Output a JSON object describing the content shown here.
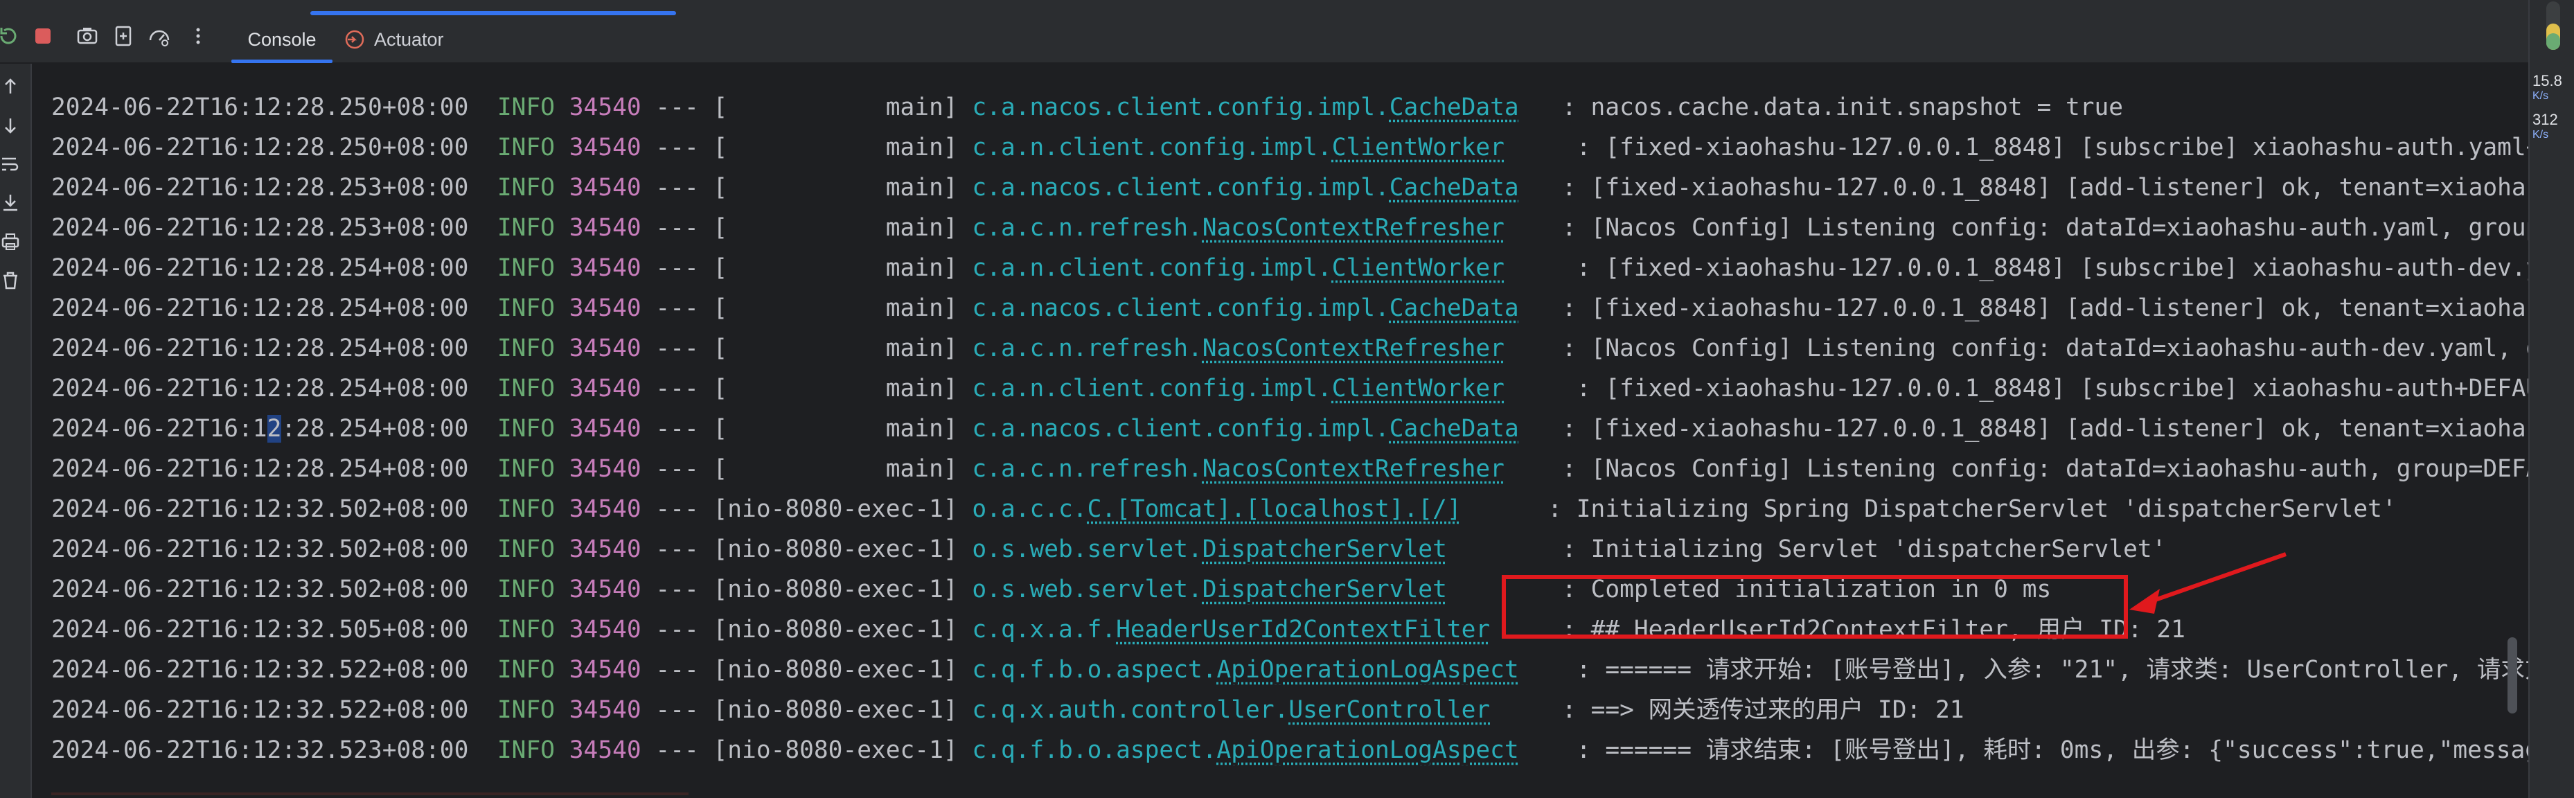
{
  "tabs": [
    {
      "label": "Console"
    },
    {
      "label": "Actuator"
    }
  ],
  "icons": {
    "toolbar": [
      "rerun-icon",
      "stop-icon",
      "camera-icon",
      "restore-icon",
      "gauge-icon",
      "more-icon"
    ],
    "gutter": [
      "scroll-up-icon",
      "scroll-down-icon",
      "soft-wrap-icon",
      "scroll-to-end-icon",
      "print-icon",
      "trash-icon"
    ],
    "actuator": "actuator-icon"
  },
  "colors": {
    "timestamp": "#bcbec4",
    "level": "#6aab73",
    "pid": "#c77dbb",
    "logger": "#2aacb8",
    "annotation": "#e0191d",
    "accent": "#3574f0"
  },
  "right_panel": {
    "value1": "15.8",
    "unit1": "K/s",
    "value2": "312",
    "unit2": "K/s"
  },
  "annotation_text_highlight": "2",
  "log_lines": [
    {
      "ts": "2024-06-22T16:12:28.250+08:00",
      "lvl": "INFO",
      "pid": "34540",
      "sep": "---",
      "thread": "[           main]",
      "lg_pre": "c.a.nacos.client.config.impl.",
      "lg_cls": "CacheData",
      "pad": "   ",
      "msg": ": nacos.cache.data.init.snapshot = true"
    },
    {
      "ts": "2024-06-22T16:12:28.250+08:00",
      "lvl": "INFO",
      "pid": "34540",
      "sep": "---",
      "thread": "[           main]",
      "lg_pre": "c.a.n.client.config.impl.",
      "lg_cls": "ClientWorker",
      "pad": "     ",
      "msg": ": [fixed-xiaohashu-127.0.0.1_8848] [subscribe] xiaohashu-auth.yaml+DEFAULT_GROUP"
    },
    {
      "ts": "2024-06-22T16:12:28.253+08:00",
      "lvl": "INFO",
      "pid": "34540",
      "sep": "---",
      "thread": "[           main]",
      "lg_pre": "c.a.nacos.client.config.impl.",
      "lg_cls": "CacheData",
      "pad": "   ",
      "msg": ": [fixed-xiaohashu-127.0.0.1_8848] [add-listener] ok, tenant=xiaohashu, dataId="
    },
    {
      "ts": "2024-06-22T16:12:28.253+08:00",
      "lvl": "INFO",
      "pid": "34540",
      "sep": "---",
      "thread": "[           main]",
      "lg_pre": "c.a.c.n.refresh.",
      "lg_cls": "NacosContextRefresher",
      "pad": "    ",
      "msg": ": [Nacos Config] Listening config: dataId=xiaohashu-auth.yaml, group=DEFAULT_GROUP"
    },
    {
      "ts": "2024-06-22T16:12:28.254+08:00",
      "lvl": "INFO",
      "pid": "34540",
      "sep": "---",
      "thread": "[           main]",
      "lg_pre": "c.a.n.client.config.impl.",
      "lg_cls": "ClientWorker",
      "pad": "     ",
      "msg": ": [fixed-xiaohashu-127.0.0.1_8848] [subscribe] xiaohashu-auth-dev.yaml+DEFAULT_GROUP"
    },
    {
      "ts": "2024-06-22T16:12:28.254+08:00",
      "lvl": "INFO",
      "pid": "34540",
      "sep": "---",
      "thread": "[           main]",
      "lg_pre": "c.a.nacos.client.config.impl.",
      "lg_cls": "CacheData",
      "pad": "   ",
      "msg": ": [fixed-xiaohashu-127.0.0.1_8848] [add-listener] ok, tenant=xiaohashu, dataId="
    },
    {
      "ts": "2024-06-22T16:12:28.254+08:00",
      "lvl": "INFO",
      "pid": "34540",
      "sep": "---",
      "thread": "[           main]",
      "lg_pre": "c.a.c.n.refresh.",
      "lg_cls": "NacosContextRefresher",
      "pad": "    ",
      "msg": ": [Nacos Config] Listening config: dataId=xiaohashu-auth-dev.yaml, group=DEFAULT_GROUP"
    },
    {
      "ts": "2024-06-22T16:12:28.254+08:00",
      "lvl": "INFO",
      "pid": "34540",
      "sep": "---",
      "thread": "[           main]",
      "lg_pre": "c.a.n.client.config.impl.",
      "lg_cls": "ClientWorker",
      "pad": "     ",
      "msg": ": [fixed-xiaohashu-127.0.0.1_8848] [subscribe] xiaohashu-auth+DEFAULT_GROUP+xiaohashu"
    },
    {
      "ts_a": "2024-06-22T16:1",
      "ts_hl": "2",
      "ts_b": ":28.254+08:00",
      "lvl": "INFO",
      "pid": "34540",
      "sep": "---",
      "thread": "[           main]",
      "lg_pre": "c.a.nacos.client.config.impl.",
      "lg_cls": "CacheData",
      "pad": "   ",
      "msg": ": [fixed-xiaohashu-127.0.0.1_8848] [add-listener] ok, tenant=xiaohashu, dataId="
    },
    {
      "ts": "2024-06-22T16:12:28.254+08:00",
      "lvl": "INFO",
      "pid": "34540",
      "sep": "---",
      "thread": "[           main]",
      "lg_pre": "c.a.c.n.refresh.",
      "lg_cls": "NacosContextRefresher",
      "pad": "    ",
      "msg": ": [Nacos Config] Listening config: dataId=xiaohashu-auth, group=DEFAULT_GROUP"
    },
    {
      "ts": "2024-06-22T16:12:32.502+08:00",
      "lvl": "INFO",
      "pid": "34540",
      "sep": "---",
      "thread": "[nio-8080-exec-1]",
      "lg_pre": "o.a.c.c.",
      "lg_cls": "C.[Tomcat].[localhost].[/]",
      "pad": "      ",
      "msg": ": Initializing Spring DispatcherServlet 'dispatcherServlet'"
    },
    {
      "ts": "2024-06-22T16:12:32.502+08:00",
      "lvl": "INFO",
      "pid": "34540",
      "sep": "---",
      "thread": "[nio-8080-exec-1]",
      "lg_pre": "o.s.web.servlet.",
      "lg_cls": "DispatcherServlet",
      "pad": "        ",
      "msg": ": Initializing Servlet 'dispatcherServlet'"
    },
    {
      "ts": "2024-06-22T16:12:32.502+08:00",
      "lvl": "INFO",
      "pid": "34540",
      "sep": "---",
      "thread": "[nio-8080-exec-1]",
      "lg_pre": "o.s.web.servlet.",
      "lg_cls": "DispatcherServlet",
      "pad": "        ",
      "msg": ": Completed initialization in 0 ms"
    },
    {
      "ts": "2024-06-22T16:12:32.505+08:00",
      "lvl": "INFO",
      "pid": "34540",
      "sep": "---",
      "thread": "[nio-8080-exec-1]",
      "lg_pre": "c.q.x.a.f.",
      "lg_cls": "HeaderUserId2ContextFilter",
      "pad": "     ",
      "msg": ": ## HeaderUserId2ContextFilter, 用户 ID: 21"
    },
    {
      "ts": "2024-06-22T16:12:32.522+08:00",
      "lvl": "INFO",
      "pid": "34540",
      "sep": "---",
      "thread": "[nio-8080-exec-1]",
      "lg_pre": "c.q.f.b.o.aspect.",
      "lg_cls": "ApiOperationLogAspect",
      "pad": "    ",
      "msg": ": ====== 请求开始: [账号登出], 入参: \"21\", 请求类: UserController, 请求方法: logout"
    },
    {
      "ts": "2024-06-22T16:12:32.522+08:00",
      "lvl": "INFO",
      "pid": "34540",
      "sep": "---",
      "thread": "[nio-8080-exec-1]",
      "lg_pre": "c.q.x.auth.controller.",
      "lg_cls": "UserController",
      "pad": "     ",
      "msg": ": ==> 网关透传过来的用户 ID: 21"
    },
    {
      "ts": "2024-06-22T16:12:32.523+08:00",
      "lvl": "INFO",
      "pid": "34540",
      "sep": "---",
      "thread": "[nio-8080-exec-1]",
      "lg_pre": "c.q.f.b.o.aspect.",
      "lg_cls": "ApiOperationLogAspect",
      "pad": "    ",
      "msg": ": ====== 请求结束: [账号登出], 耗时: 0ms, 出参: {\"success\":true,\"message\":null"
    }
  ]
}
